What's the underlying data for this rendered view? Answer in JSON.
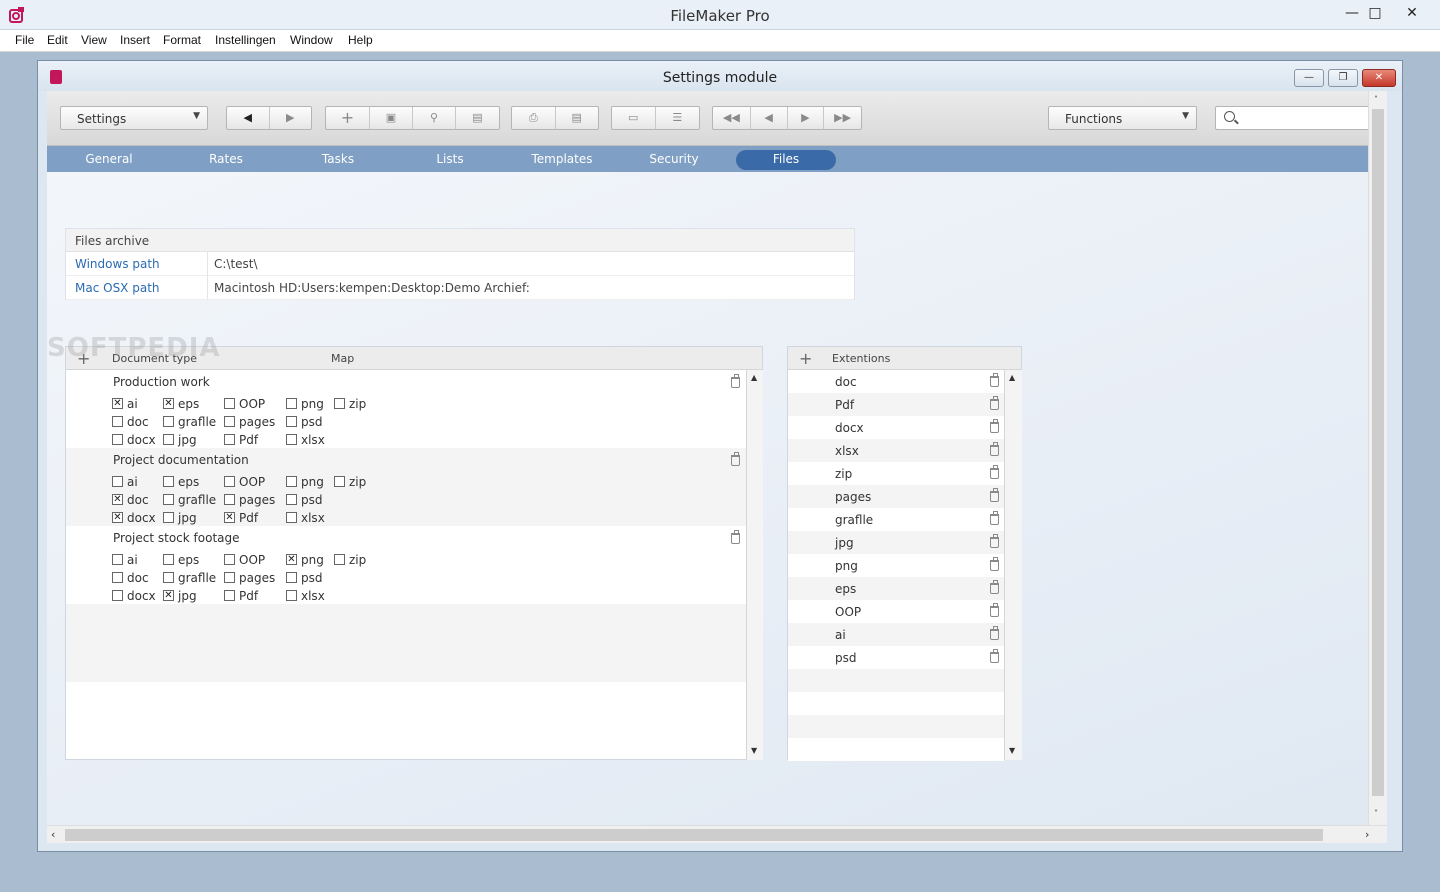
{
  "app": {
    "title": "FileMaker Pro"
  },
  "menu": [
    "File",
    "Edit",
    "View",
    "Insert",
    "Format",
    "Instellingen",
    "Window",
    "Help"
  ],
  "window": {
    "title": "Settings module"
  },
  "toolbar": {
    "settings_select": "Settings",
    "functions_select": "Functions",
    "search_placeholder": ""
  },
  "tabs": [
    {
      "label": "General",
      "active": false
    },
    {
      "label": "Rates",
      "active": false
    },
    {
      "label": "Tasks",
      "active": false
    },
    {
      "label": "Lists",
      "active": false
    },
    {
      "label": "Templates",
      "active": false
    },
    {
      "label": "Security",
      "active": false
    },
    {
      "label": "Files",
      "active": true
    }
  ],
  "archive": {
    "title": "Files archive",
    "rows": [
      {
        "label": "Windows path",
        "value": "C:\\test\\"
      },
      {
        "label": "Mac OSX path",
        "value": "Macintosh HD:Users:kempen:Desktop:Demo Archief:"
      }
    ]
  },
  "documents": {
    "col_type": "Document type",
    "col_map": "Map",
    "groups": [
      {
        "title": "Production work",
        "checks": [
          [
            {
              "label": "ai",
              "checked": true
            },
            {
              "label": "eps",
              "checked": true
            },
            {
              "label": "OOP",
              "checked": false
            },
            {
              "label": "png",
              "checked": false
            },
            {
              "label": "zip",
              "checked": false
            }
          ],
          [
            {
              "label": "doc",
              "checked": false
            },
            {
              "label": "graflle",
              "checked": false
            },
            {
              "label": "pages",
              "checked": false
            },
            {
              "label": "psd",
              "checked": false
            }
          ],
          [
            {
              "label": "docx",
              "checked": false
            },
            {
              "label": "jpg",
              "checked": false
            },
            {
              "label": "Pdf",
              "checked": false
            },
            {
              "label": "xlsx",
              "checked": false
            }
          ]
        ]
      },
      {
        "title": "Project documentation",
        "checks": [
          [
            {
              "label": "ai",
              "checked": false
            },
            {
              "label": "eps",
              "checked": false
            },
            {
              "label": "OOP",
              "checked": false
            },
            {
              "label": "png",
              "checked": false
            },
            {
              "label": "zip",
              "checked": false
            }
          ],
          [
            {
              "label": "doc",
              "checked": true
            },
            {
              "label": "graflle",
              "checked": false
            },
            {
              "label": "pages",
              "checked": false
            },
            {
              "label": "psd",
              "checked": false
            }
          ],
          [
            {
              "label": "docx",
              "checked": true
            },
            {
              "label": "jpg",
              "checked": false
            },
            {
              "label": "Pdf",
              "checked": true
            },
            {
              "label": "xlsx",
              "checked": false
            }
          ]
        ]
      },
      {
        "title": "Project stock footage",
        "checks": [
          [
            {
              "label": "ai",
              "checked": false
            },
            {
              "label": "eps",
              "checked": false
            },
            {
              "label": "OOP",
              "checked": false
            },
            {
              "label": "png",
              "checked": true
            },
            {
              "label": "zip",
              "checked": false
            }
          ],
          [
            {
              "label": "doc",
              "checked": false
            },
            {
              "label": "graflle",
              "checked": false
            },
            {
              "label": "pages",
              "checked": false
            },
            {
              "label": "psd",
              "checked": false
            }
          ],
          [
            {
              "label": "docx",
              "checked": false
            },
            {
              "label": "jpg",
              "checked": true
            },
            {
              "label": "Pdf",
              "checked": false
            },
            {
              "label": "xlsx",
              "checked": false
            }
          ]
        ]
      }
    ]
  },
  "extensions": {
    "header": "Extentions",
    "items": [
      "doc",
      "Pdf",
      "docx",
      "xlsx",
      "zip",
      "pages",
      "graflle",
      "jpg",
      "png",
      "eps",
      "OOP",
      "ai",
      "psd"
    ]
  },
  "watermark": "SOFTPEDIA",
  "colors": {
    "tabbar": "#7fa0c4",
    "active_tab": "#3a6ba8",
    "link": "#2a6bb3"
  }
}
